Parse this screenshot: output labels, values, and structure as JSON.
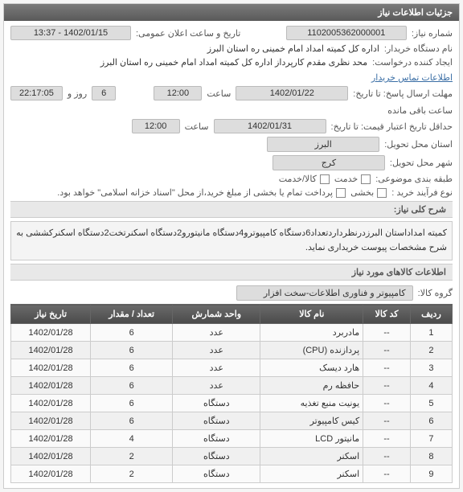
{
  "header": {
    "title": "جزئیات اطلاعات نیاز"
  },
  "info": {
    "need_no_label": "شماره نیاز:",
    "need_no": "1102005362000001",
    "pub_datetime_label": "تاریخ و ساعت اعلان عمومی:",
    "pub_datetime": "1402/01/15 - 13:37",
    "buyer_label": "نام دستگاه خریدار:",
    "buyer": "اداره کل کمیته امداد امام خمینی ره استان البرز",
    "requester_label": "ایجاد کننده درخواست:",
    "requester": "محد نظری مقدم کارپرداز اداره کل کمیته امداد امام خمینی ره استان البرز",
    "contact_link": "اطلاعات تماس خریدار",
    "deadline_label": "مهلت ارسال پاسخ: تا تاریخ:",
    "deadline_date": "1402/01/22",
    "time_label": "ساعت",
    "deadline_time": "12:00",
    "days_label": "روز و",
    "days": "6",
    "remain_time": "22:17:05",
    "remain_label": "ساعت باقی مانده",
    "min_valid_label": "حداقل تاریخ اعتبار قیمت: تا تاریخ:",
    "min_valid_date": "1402/01/31",
    "min_valid_time": "12:00",
    "province_label": "استان محل تحویل:",
    "province": "البرز",
    "city_label": "شهر محل تحویل:",
    "city": "کرج",
    "class_label": "طبقه بندی موضوعی:",
    "class_service": "خدمت",
    "class_product": "کالا/خدمت",
    "process_label": "نوع فرآیند خرید :",
    "process_cb1": "بخشی",
    "process_note": "پرداخت تمام یا بخشی از مبلغ خرید،از محل \"اسناد خزانه اسلامی\" خواهد بود."
  },
  "section_overview": {
    "title": "شرح کلی نیاز:",
    "text": "کمیته امداداستان البرزدرنظرداردتعداد6دستگاه کامپیوترو4دستگاه مانیتورو2دستگاه اسکنرتخت2دستگاه اسکنرکششی به شرح مشخصات پیوست خریداری نماید."
  },
  "section_items": {
    "title": "اطلاعات کالاهای مورد نیاز",
    "group_label": "گروه کالا:",
    "group_value": "کامپیوتر و فناوری اطلاعات-سخت افزار"
  },
  "table": {
    "headers": [
      "ردیف",
      "کد کالا",
      "نام کالا",
      "واحد شمارش",
      "تعداد / مقدار",
      "تاریخ نیاز"
    ],
    "rows": [
      {
        "idx": "1",
        "code": "--",
        "name": "مادربرد",
        "unit": "عدد",
        "qty": "6",
        "date": "1402/01/28"
      },
      {
        "idx": "2",
        "code": "--",
        "name": "پردازنده (CPU)",
        "unit": "عدد",
        "qty": "6",
        "date": "1402/01/28"
      },
      {
        "idx": "3",
        "code": "--",
        "name": "هارد دیسک",
        "unit": "عدد",
        "qty": "6",
        "date": "1402/01/28"
      },
      {
        "idx": "4",
        "code": "--",
        "name": "حافظه رم",
        "unit": "عدد",
        "qty": "6",
        "date": "1402/01/28"
      },
      {
        "idx": "5",
        "code": "--",
        "name": "یونیت منبع تغذیه",
        "unit": "دستگاه",
        "qty": "6",
        "date": "1402/01/28"
      },
      {
        "idx": "6",
        "code": "--",
        "name": "کیس کامپیوتر",
        "unit": "دستگاه",
        "qty": "6",
        "date": "1402/01/28"
      },
      {
        "idx": "7",
        "code": "--",
        "name": "مانیتور LCD",
        "unit": "دستگاه",
        "qty": "4",
        "date": "1402/01/28"
      },
      {
        "idx": "8",
        "code": "--",
        "name": "اسکنر",
        "unit": "دستگاه",
        "qty": "2",
        "date": "1402/01/28"
      },
      {
        "idx": "9",
        "code": "--",
        "name": "اسکنر",
        "unit": "دستگاه",
        "qty": "2",
        "date": "1402/01/28"
      }
    ]
  }
}
